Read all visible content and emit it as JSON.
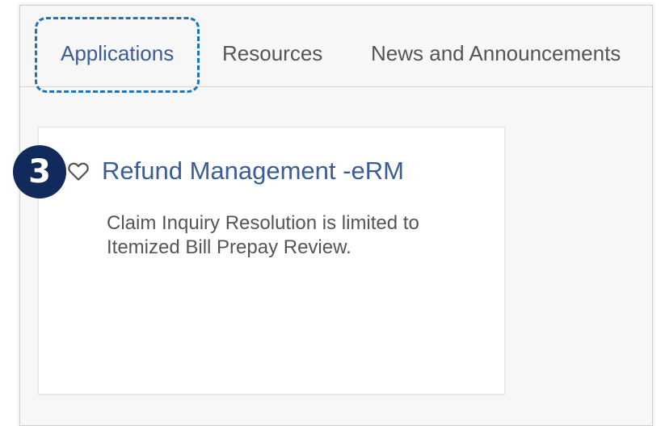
{
  "tabs": {
    "applications": "Applications",
    "resources": "Resources",
    "news": "News and Announcements"
  },
  "card": {
    "title": "Refund Management -eRM",
    "description": "Claim Inquiry Resolution is limited to Itemized Bill Prepay Review.",
    "favorite_icon": "heart-outline-icon"
  },
  "annotation": {
    "step_number": "3"
  },
  "colors": {
    "link_blue": "#3a5c97",
    "highlight_dashed_border": "#1e73b8",
    "badge_navy": "#102a5c"
  }
}
